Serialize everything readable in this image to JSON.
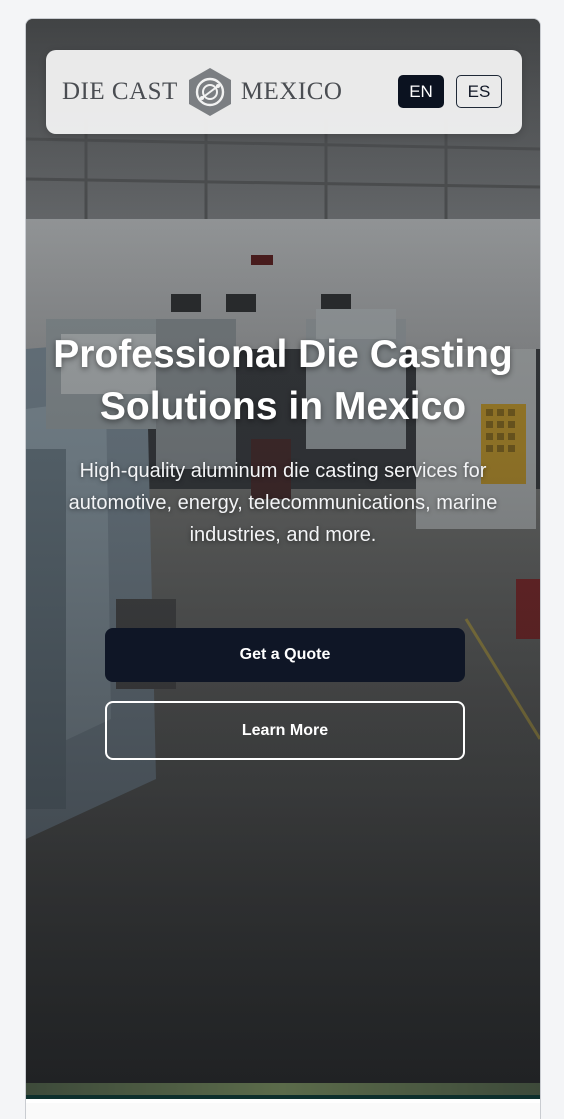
{
  "header": {
    "logo_left": "DIE CAST",
    "logo_right": "MEXICO",
    "logo_icon": "hexagon-gear-icon",
    "languages": [
      "EN",
      "ES"
    ],
    "active_language": "EN"
  },
  "hero": {
    "title": "Professional Die Casting Solutions in Mexico",
    "subtitle": "High-quality aluminum die casting services for automotive, energy, telecommunications, marine industries, and more.",
    "primary_button": "Get a Quote",
    "secondary_button": "Learn More"
  },
  "colors": {
    "primary_button_bg": "#0f1626",
    "active_lang_bg": "#0b1220",
    "header_bg": "#f0f0f0",
    "text_on_hero": "#ffffff"
  }
}
